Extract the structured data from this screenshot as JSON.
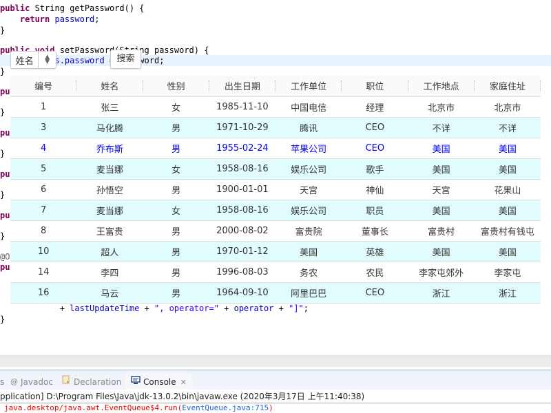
{
  "editor": {
    "lines": {
      "l1_kw": "public",
      "l1_rest": " String getPassword() {",
      "l2_kw": "    return",
      "l2_fld": " password",
      "l2_end": ";",
      "l3": "}",
      "l5_kw": "public void",
      "l5_rest": " setPassword(String password) {",
      "l6_fld": "        this.password",
      "l6_rest": " = password;",
      "l7": "}",
      "gutter_pu": "pu",
      "gutter_brace": "}",
      "gutter_at": "@O",
      "tail_line_prefix": "            + ",
      "tail_fld1": "lastUpdateTime",
      "tail_mid1": " + ",
      "tail_str1": "\", operator=\"",
      "tail_mid2": " + ",
      "tail_fld2": "operator",
      "tail_mid3": " + ",
      "tail_str2": "\"]\"",
      "tail_end": ";",
      "close_brace": "}"
    }
  },
  "search": {
    "field_selected": "姓名",
    "spinner_up": "▲",
    "spinner_down": "▼",
    "button_label": "搜索"
  },
  "table": {
    "columns": [
      "编号",
      "姓名",
      "性别",
      "出生日期",
      "工作单位",
      "职位",
      "工作地点",
      "家庭住址"
    ],
    "rows": [
      [
        "1",
        "张三",
        "女",
        "1985-11-10",
        "中国电信",
        "经理",
        "北京市",
        "北京市"
      ],
      [
        "3",
        "马化腾",
        "男",
        "1971-10-29",
        "腾讯",
        "CEO",
        "不详",
        "不详"
      ],
      [
        "4",
        "乔布斯",
        "男",
        "1955-02-24",
        "苹果公司",
        "CEO",
        "美国",
        "美国"
      ],
      [
        "5",
        "麦当娜",
        "女",
        "1958-08-16",
        "娱乐公司",
        "歌手",
        "美国",
        "美国"
      ],
      [
        "6",
        "孙悟空",
        "男",
        "1900-01-01",
        "天宫",
        "神仙",
        "天宫",
        "花果山"
      ],
      [
        "7",
        "麦当娜",
        "女",
        "1958-08-16",
        "娱乐公司",
        "职员",
        "美国",
        "美国"
      ],
      [
        "8",
        "王富贵",
        "男",
        "2000-08-02",
        "富贵院",
        "董事长",
        "富贵村",
        "富贵村有钱屯"
      ],
      [
        "10",
        "超人",
        "男",
        "1970-01-12",
        "美国",
        "英雄",
        "美国",
        "美国"
      ],
      [
        "14",
        "李四",
        "男",
        "1996-08-03",
        "务农",
        "农民",
        "李家屯郊外",
        "李家屯"
      ],
      [
        "16",
        "马云",
        "男",
        "1964-09-10",
        "阿里巴巴",
        "CEO",
        "浙江",
        "浙江"
      ]
    ],
    "selected_row_index": 2,
    "colors": {
      "alt_row": "#e0fcfc",
      "selected_text": "#0000ee"
    }
  },
  "panel": {
    "tabs": [
      {
        "label": "s",
        "icon": ""
      },
      {
        "label": "Javadoc",
        "icon": "@"
      },
      {
        "label": "Declaration",
        "icon": "declaration-icon"
      },
      {
        "label": "Console",
        "icon": "console-icon",
        "active": true,
        "close": "✕"
      }
    ],
    "console_info": "pplication] D:\\Program Files\\Java\\jdk-13.0.2\\bin\\javaw.exe (2020年3月17日 上午11:40:38)",
    "console_line_prefix": "java.desktop/java.awt.EventQueue$4.run(",
    "console_line_link": "EventQueue.java:715",
    "console_line_suffix": ")"
  }
}
